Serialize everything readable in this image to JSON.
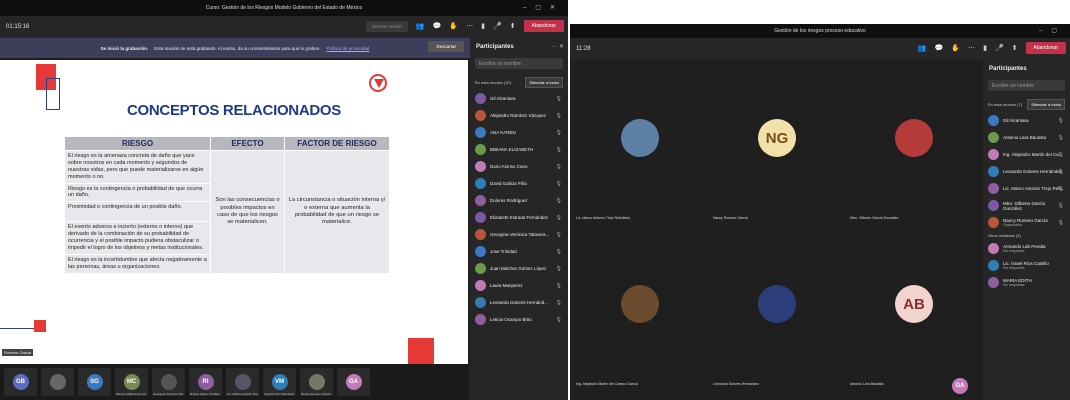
{
  "w1": {
    "title": "Curso: Gestión de los Riesgos Modelo Gobierno del Estado de México",
    "timer": "01:15:16",
    "share_disabled": "Detener sesión",
    "leave": "Abandonar",
    "recording": {
      "bold": "Se inició la grabación.",
      "text": "Esta reunión se está grabando. Al unirse, da su consentimiento para que lo graben.",
      "link": "Política de privacidad",
      "dismiss": "Descartar"
    },
    "slide": {
      "title": "CONCEPTOS RELACIONADOS",
      "headers": [
        "RIESGO",
        "EFECTO",
        "FACTOR DE RIESGO"
      ],
      "riesgo": [
        "El riesgo es la amenaza concreta de daño que yace sobre nosotros en cada momento y segundos de nuestras vidas, pero que puede materializarse en algún momento o no.",
        "Riesgo es la contingencia o probabilidad de que ocurra un daño.",
        "Proximidad o contingencia de un posible daño.",
        "El evento adverso e incierto (externo o interno) que derivado de la combinación de su probabilidad de ocurrencia y el posible impacto pudiera obstaculizar o impedir el logro de los objetivos y metas institucionales.",
        "El riesgo es la incertidumbre que afecta negativamente a las personas, áreas u organizaciones."
      ],
      "efecto": "Son las consecuencias o posibles impactos en caso de que los riesgos se materialicen.",
      "factor": "La circunstancia o situación interna y/ o externa que aumenta la probabilidad de que un riesgo se materialice."
    },
    "presenter_chip": "Romero Garcia",
    "tiles": [
      {
        "initials": "GB",
        "color": "#5b6bbf",
        "name": ""
      },
      {
        "initials": "",
        "color": "#666",
        "name": ""
      },
      {
        "initials": "SG",
        "color": "#3b78c2",
        "name": ""
      },
      {
        "initials": "MC",
        "color": "#7a8a55",
        "name": "Mónica Valdovinos Ca..."
      },
      {
        "initials": "",
        "color": "#555",
        "name": "Georgina Verónica Tal..."
      },
      {
        "initials": "RI",
        "color": "#8e5f9e",
        "name": "Ricitos Ingles Trinidad"
      },
      {
        "initials": "",
        "color": "#556",
        "name": "Lic. Marco Antonio Trej..."
      },
      {
        "initials": "VM",
        "color": "#2f7fb5",
        "name": "Virginia Ortiz Mendoza"
      },
      {
        "initials": "",
        "color": "#776",
        "name": "Nancy Romero García"
      },
      {
        "initials": "GA",
        "color": "#c47ab8",
        "name": ""
      }
    ],
    "participants": {
      "title": "Participantes",
      "search": "Escriba un nombre",
      "section": "En esta reunión (37)",
      "mute_all": "Silenciar a todos",
      "items": [
        "Gil Alcantara",
        "Alejandro Ramírez Vázquez",
        "ANA KAREN",
        "BIBIANA ELIZABETH",
        "Dario Alonso Cano",
        "David Galicia Piña",
        "Dolores Rodríguez",
        "Elizabeth Estrada Fernández",
        "Georgina Verónica Talavera...",
        "Jose Trinidad",
        "Juan Melchor Gómez López",
        "Laura Manjarrez",
        "Leonardo Dolores Hernánd...",
        "Leticia Ocampo Brito"
      ]
    }
  },
  "w2": {
    "title": "Gestión de los riesgos proceso educativo",
    "timer": "11:28",
    "leave": "Abandonar",
    "videos": [
      {
        "name": "Lic. Marco Antonio Trejo Rebolledo",
        "initials": "",
        "bg": "#5d7fa3"
      },
      {
        "name": "Nancy Romero García",
        "initials": "NG",
        "bg": "#f3e1ab"
      },
      {
        "name": "Mtro. Gilberto García González",
        "initials": "",
        "bg": "#b53b3b"
      },
      {
        "name": "Ing. Alejandro Martín del Campo García",
        "initials": "",
        "bg": "#6b4a2e"
      },
      {
        "name": "Leonardo Dolores Hernández",
        "initials": "",
        "bg": "#2c3f7a"
      },
      {
        "name": "Antonio Lara Bautista",
        "initials": "AB",
        "bg": "#f2d4cf"
      }
    ],
    "ga_initials": "GA",
    "participants": {
      "title": "Participantes",
      "search": "Escribe un nombre",
      "section": "En esta reunión (7)",
      "mute_all": "Silenciar a todos",
      "items": [
        {
          "n": "Gil Alcantara",
          "s": ""
        },
        {
          "n": "Antonio Lara Bautista",
          "s": ""
        },
        {
          "n": "Ing. Alejandro Martín del Ca...",
          "s": ""
        },
        {
          "n": "Leonardo Dolores Hernández",
          "s": ""
        },
        {
          "n": "Lic. Marco Antonio Trejo Reb...",
          "s": ""
        },
        {
          "n": "Mtro. Gilberto García González",
          "s": ""
        },
        {
          "n": "Nancy Romero García",
          "s": "Organizador"
        }
      ],
      "invited_section": "Otros invitados (3)",
      "invited": [
        {
          "n": "Armando Lab Peralta",
          "s": "Sin respuesta"
        },
        {
          "n": "Lic. Israel Ríos Castillo",
          "s": "Sin respuesta"
        },
        {
          "n": "MARIA EDITH",
          "s": "Sin respuesta"
        }
      ]
    }
  }
}
